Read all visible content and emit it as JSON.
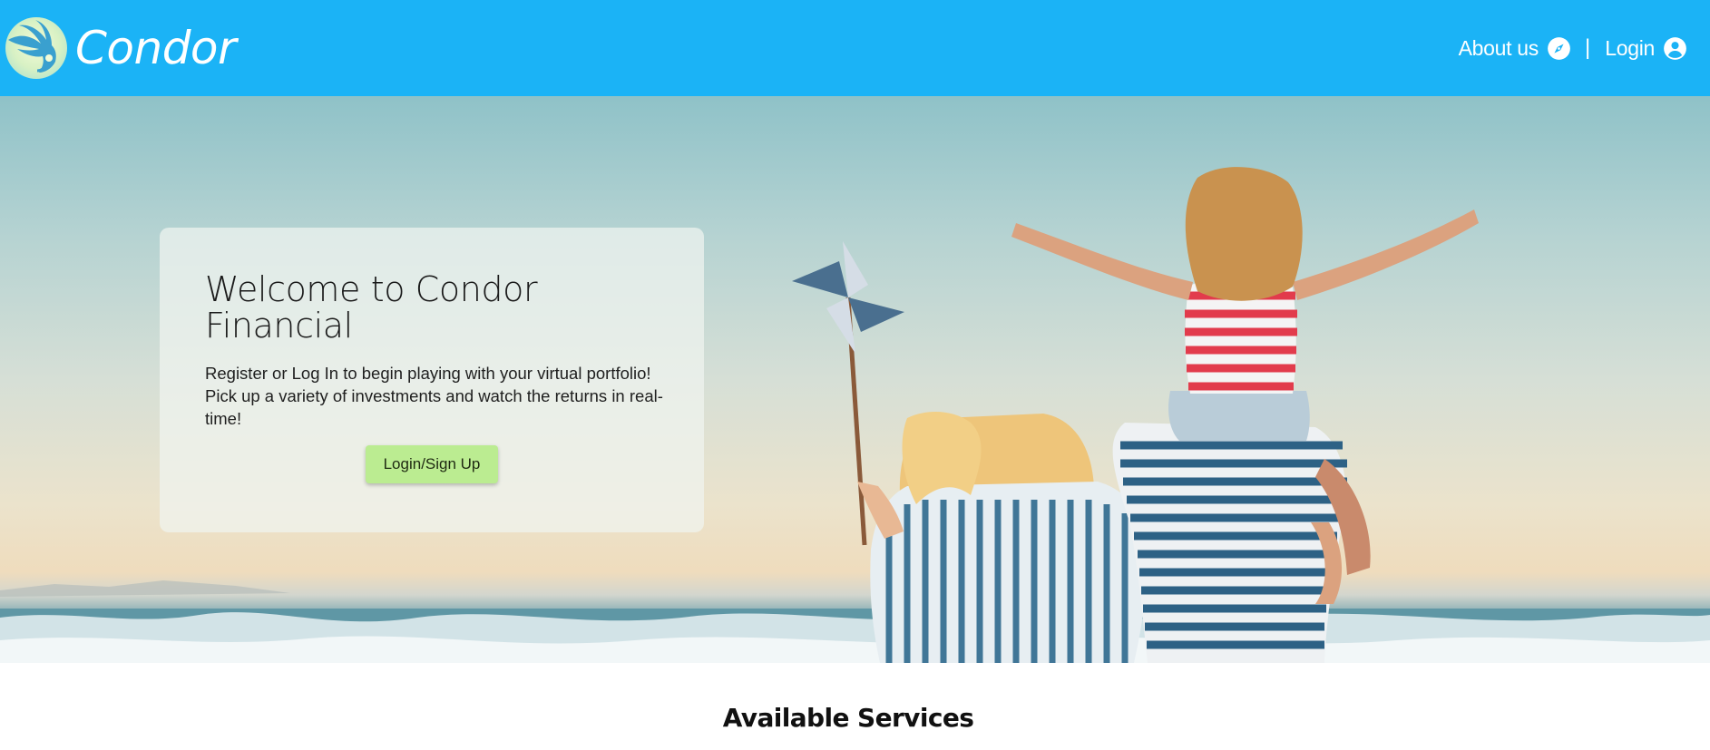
{
  "header": {
    "brand_name": "Condor",
    "logo_icon": "condor-logo-icon",
    "nav": [
      {
        "label": "About us",
        "icon": "compass-icon"
      },
      {
        "label": "Login",
        "icon": "user-circle-icon"
      }
    ],
    "separator": "|"
  },
  "hero": {
    "title": "Welcome to Condor Financial",
    "body": "Register or Log In to begin playing with your virtual portfolio! Pick up a variety of investments and watch the returns in real-time!",
    "cta_label": "Login/Sign Up"
  },
  "services": {
    "title": "Available Services"
  },
  "colors": {
    "header_bg": "#1bb3f6",
    "cta_bg": "#bbec91"
  }
}
